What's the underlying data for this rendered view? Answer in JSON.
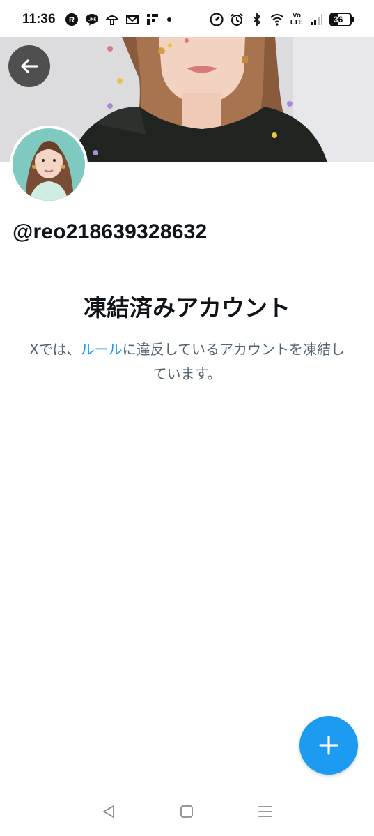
{
  "status_bar": {
    "time": "11:36",
    "left_icons": [
      "rakuten-link-icon",
      "line-icon",
      "mushroom-icon",
      "mail-icon",
      "app-icon"
    ],
    "volte": "Vo\nLTE",
    "battery_level": "36",
    "battery_fraction": 0.36
  },
  "profile": {
    "handle": "@reo218639328632"
  },
  "suspended": {
    "title": "凍結済みアカウント",
    "message_prefix": "Xでは、",
    "rules_link": "ルール",
    "message_suffix": "に違反しているアカウントを凍結しています。"
  },
  "colors": {
    "accent": "#1d9bf0",
    "text_primary": "#0f1419",
    "text_secondary": "#536471"
  },
  "icons": {
    "back": "arrow-left-icon",
    "fab": "plus-icon",
    "nav_back": "triangle-back-icon",
    "nav_home": "square-home-icon",
    "nav_menu": "menu-lines-icon"
  }
}
